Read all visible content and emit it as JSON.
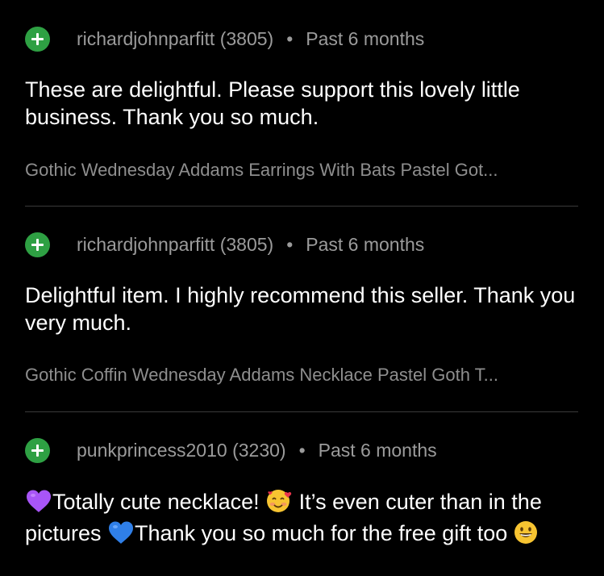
{
  "reviews": [
    {
      "username": "richardjohnparfitt (3805)",
      "separator": "•",
      "time": "Past 6 months",
      "text": "These are delightful. Please support this lovely little business. Thank you so much.",
      "item": "Gothic Wednesday Addams Earrings With Bats Pastel Got..."
    },
    {
      "username": "richardjohnparfitt (3805)",
      "separator": "•",
      "time": "Past 6 months",
      "text": "Delightful item. I highly recommend this seller. Thank you very much.",
      "item": "Gothic Coffin Wednesday Addams Necklace Pastel Goth T..."
    },
    {
      "username": "punkprincess2010 (3230)",
      "separator": "•",
      "time": "Past 6 months",
      "text_parts": [
        "Totally cute necklace! ",
        " It’s even cuter than in the pictures ",
        "Thank you so much for the free gift too "
      ]
    }
  ],
  "colors": {
    "background": "#000000",
    "text": "#ffffff",
    "muted": "#9b9b9b",
    "divider": "#3a3a3a",
    "positive": "#2ea043"
  },
  "icons": [
    "plus-icon",
    "purple-heart-icon",
    "smiling-face-with-hearts-icon",
    "blue-heart-icon",
    "grinning-face-icon"
  ]
}
